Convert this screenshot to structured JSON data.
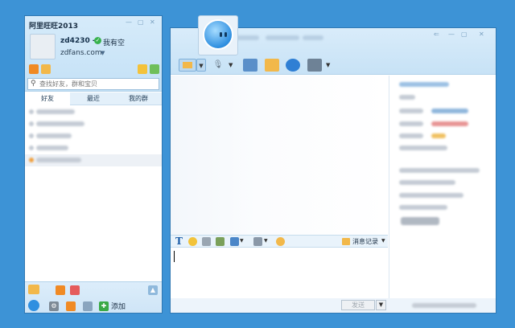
{
  "left_window": {
    "title": "阿里旺旺2013",
    "username": "zd4230 -",
    "status": "我有空",
    "signature": "zdfans.com",
    "search": {
      "placeholder": "查找好友，群和宝贝"
    },
    "tabs": [
      "好友",
      "最近",
      "我的群"
    ],
    "contacts_count": 5,
    "add_label": "添加"
  },
  "chat_window": {
    "message_record_label": "消息记录",
    "send_label": "发送"
  },
  "colors": {
    "desktop": "#3d93d6",
    "window_border": "#2f78b3",
    "toolbar_tint": "#c7e2f6",
    "status_online": "#37b24d"
  }
}
